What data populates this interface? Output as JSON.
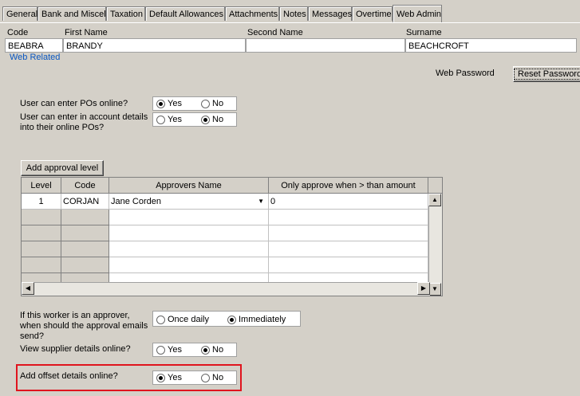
{
  "tabs": [
    {
      "label": "General"
    },
    {
      "label": "Bank and Miscel"
    },
    {
      "label": "Taxation"
    },
    {
      "label": "Default Allowances"
    },
    {
      "label": "Attachments"
    },
    {
      "label": "Notes"
    },
    {
      "label": "Messages"
    },
    {
      "label": "Overtime"
    },
    {
      "label": "Web Admin",
      "active": true
    }
  ],
  "header": {
    "code_label": "Code",
    "first_name_label": "First Name",
    "second_name_label": "Second Name",
    "surname_label": "Surname",
    "code": "BEABRA",
    "first_name": "BRANDY",
    "second_name": "",
    "surname": "BEACHCROFT"
  },
  "section_label": "Web Related",
  "web_password": {
    "label": "Web Password",
    "button": "Reset Password"
  },
  "po_online": {
    "question": "User can enter POs online?",
    "yes": "Yes",
    "no": "No",
    "selected": "yes"
  },
  "account_details": {
    "question_line1": "User can enter in account details",
    "question_line2": "into their online POs?",
    "yes": "Yes",
    "no": "No",
    "selected": "no"
  },
  "add_approval_button": "Add approval level",
  "approval_table": {
    "columns": [
      "Level",
      "Code",
      "Approvers Name",
      "Only approve when > than amount"
    ],
    "rows": [
      {
        "level": "1",
        "code": "CORJAN",
        "name": "Jane Corden",
        "amount": "0"
      }
    ]
  },
  "approver_email": {
    "line1": "If this worker is an approver,",
    "line2": "when should the approval emails",
    "line3": "send?",
    "opt1": "Once daily",
    "opt2": "Immediately",
    "selected": "immediately"
  },
  "supplier_details": {
    "question": "View supplier details online?",
    "yes": "Yes",
    "no": "No",
    "selected": "no"
  },
  "offset_details": {
    "question": "Add offset details online?",
    "yes": "Yes",
    "no": "No",
    "selected": "yes"
  },
  "colors": {
    "link": "#0b58c2",
    "highlight": "#e0141e",
    "face": "#d4d0c8"
  }
}
